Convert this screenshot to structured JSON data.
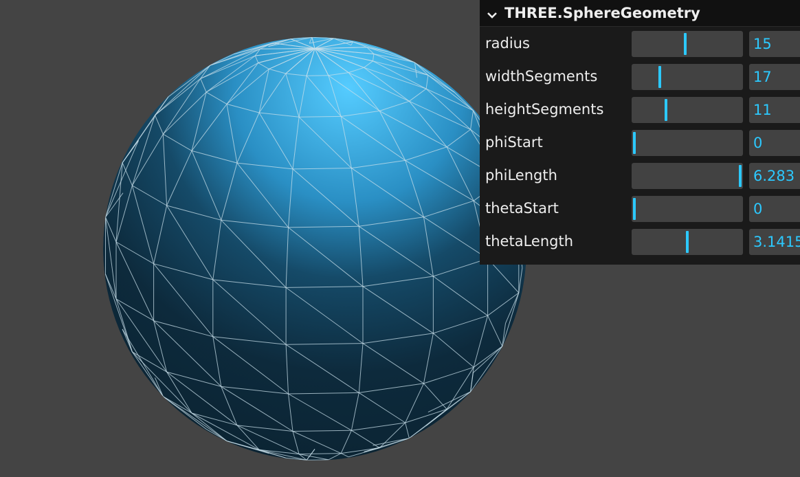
{
  "colors": {
    "background": "#444444",
    "panel": "#1a1a1a",
    "accent": "#2cc9ff",
    "sphere_light": "#4ec3f5",
    "sphere_dark": "#0e2b3d",
    "wireframe": "#c8dfe9"
  },
  "gui": {
    "title": "THREE.SphereGeometry",
    "collapse_icon": "chevron-down-icon",
    "rows": [
      {
        "key": "radius",
        "label": "radius",
        "value": "15",
        "fill": 0.48
      },
      {
        "key": "width-segments",
        "label": "widthSegments",
        "value": "17",
        "fill": 0.24
      },
      {
        "key": "height-segments",
        "label": "heightSegments",
        "value": "11",
        "fill": 0.3
      },
      {
        "key": "phi-start",
        "label": "phiStart",
        "value": "0",
        "fill": 0.0
      },
      {
        "key": "phi-length",
        "label": "phiLength",
        "value": "6.283",
        "fill": 1.0
      },
      {
        "key": "theta-start",
        "label": "thetaStart",
        "value": "0",
        "fill": 0.0
      },
      {
        "key": "theta-length",
        "label": "thetaLength",
        "value": "3.1415",
        "fill": 0.5
      }
    ]
  }
}
